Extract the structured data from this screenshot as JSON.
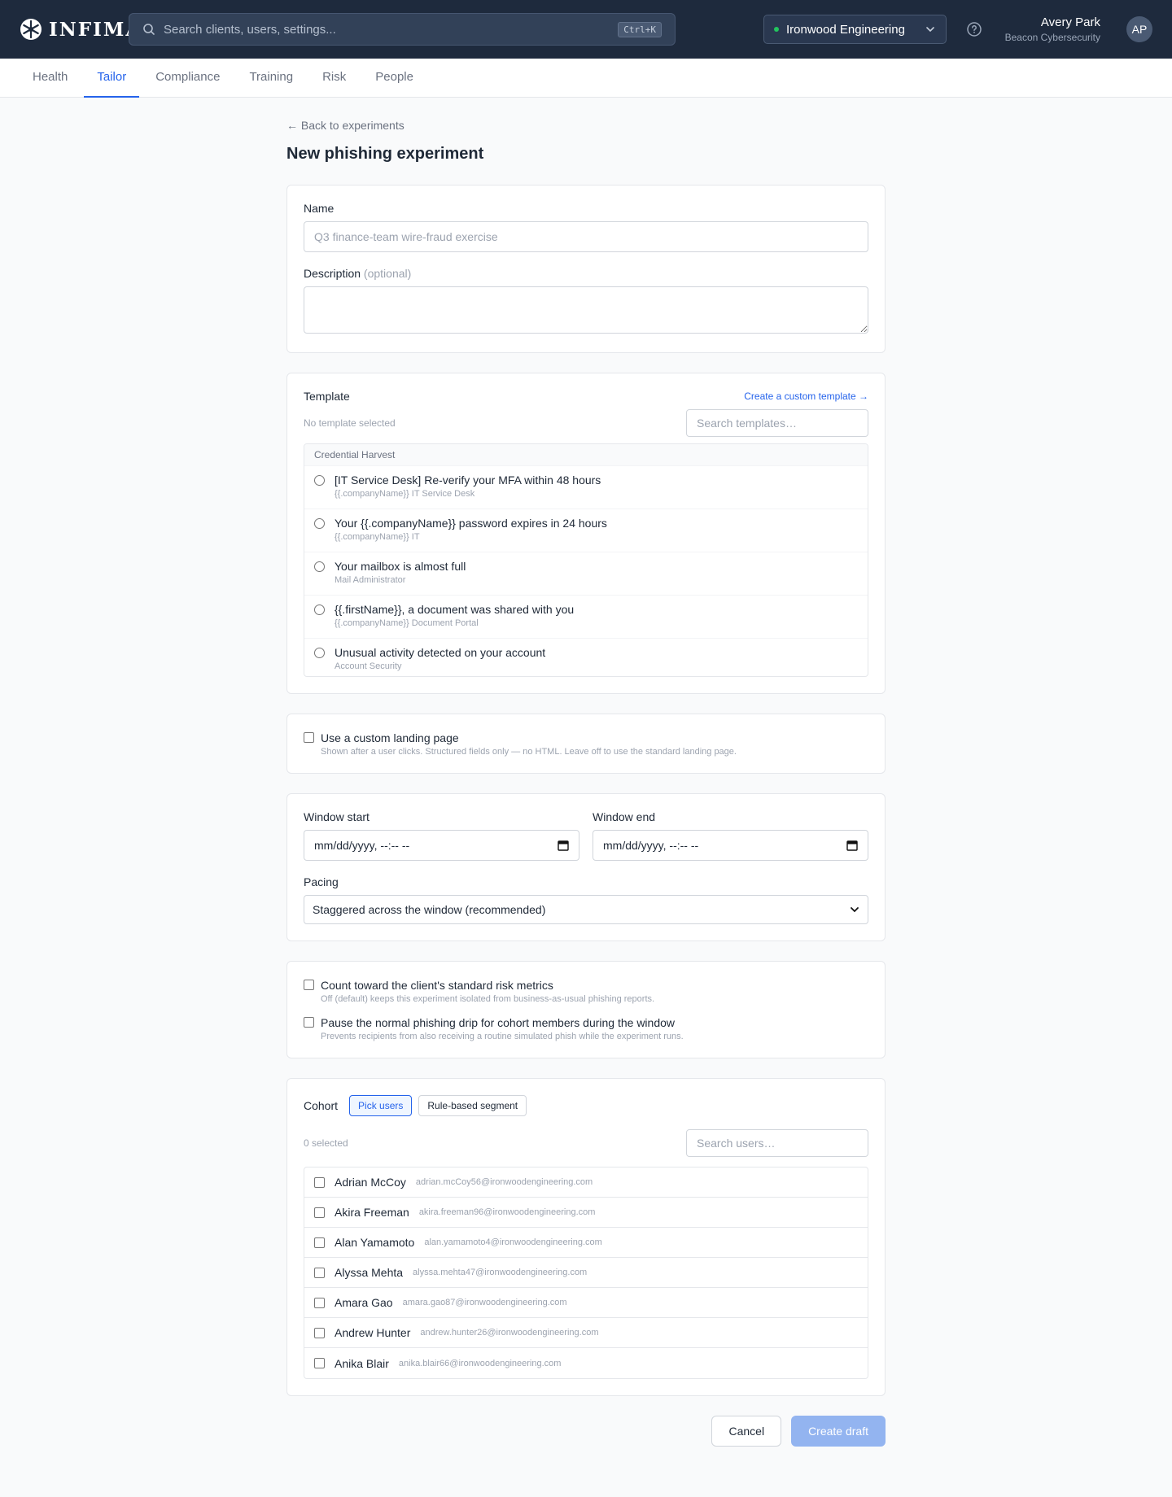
{
  "app": {
    "logo_text": "INFIMA"
  },
  "search": {
    "placeholder": "Search clients, users, settings...",
    "shortcut": "Ctrl+K"
  },
  "org_switcher": {
    "name": "Ironwood Engineering",
    "status_color": "#22c55e"
  },
  "user": {
    "name": "Avery Park",
    "org": "Beacon Cybersecurity",
    "initials": "AP"
  },
  "nav": {
    "tabs": [
      {
        "label": "Health",
        "active": false
      },
      {
        "label": "Tailor",
        "active": true
      },
      {
        "label": "Compliance",
        "active": false
      },
      {
        "label": "Training",
        "active": false
      },
      {
        "label": "Risk",
        "active": false
      },
      {
        "label": "People",
        "active": false
      }
    ]
  },
  "page": {
    "back_link": "← Back to experiments",
    "title": "New phishing experiment"
  },
  "form": {
    "name_label": "Name",
    "name_placeholder": "Q3 finance-team wire-fraud exercise",
    "description_label": "Description",
    "description_optional": "(optional)"
  },
  "template": {
    "label": "Template",
    "create_link": "Create a custom template →",
    "selected_status": "No template selected",
    "search_placeholder": "Search templates…",
    "group": "Credential Harvest",
    "items": [
      {
        "title": "[IT Service Desk] Re-verify your MFA within 48 hours",
        "sender": "{{.companyName}} IT Service Desk"
      },
      {
        "title": "Your {{.companyName}} password expires in 24 hours",
        "sender": "{{.companyName}} IT"
      },
      {
        "title": "Your mailbox is almost full",
        "sender": "Mail Administrator"
      },
      {
        "title": "{{.firstName}}, a document was shared with you",
        "sender": "{{.companyName}} Document Portal"
      },
      {
        "title": "Unusual activity detected on your account",
        "sender": "Account Security"
      }
    ]
  },
  "landing": {
    "label": "Use a custom landing page",
    "help": "Shown after a user clicks. Structured fields only — no HTML. Leave off to use the standard landing page."
  },
  "schedule": {
    "start_label": "Window start",
    "start_value": "mm/dd/yyyy, --:-- --",
    "end_label": "Window end",
    "end_value": "mm/dd/yyyy, --:-- --",
    "pacing_label": "Pacing",
    "pacing_value": "Staggered across the window (recommended)"
  },
  "options": {
    "metrics_label": "Count toward the client's standard risk metrics",
    "metrics_help": "Off (default) keeps this experiment isolated from business-as-usual phishing reports.",
    "pause_label": "Pause the normal phishing drip for cohort members during the window",
    "pause_help": "Prevents recipients from also receiving a routine simulated phish while the experiment runs."
  },
  "cohort": {
    "label": "Cohort",
    "mode_pick": "Pick users",
    "mode_rule": "Rule-based segment",
    "selected_count": "0 selected",
    "search_placeholder": "Search users…",
    "users": [
      {
        "name": "Adrian McCoy",
        "email": "adrian.mcCoy56@ironwoodengineering.com"
      },
      {
        "name": "Akira Freeman",
        "email": "akira.freeman96@ironwoodengineering.com"
      },
      {
        "name": "Alan Yamamoto",
        "email": "alan.yamamoto4@ironwoodengineering.com"
      },
      {
        "name": "Alyssa Mehta",
        "email": "alyssa.mehta47@ironwoodengineering.com"
      },
      {
        "name": "Amara Gao",
        "email": "amara.gao87@ironwoodengineering.com"
      },
      {
        "name": "Andrew Hunter",
        "email": "andrew.hunter26@ironwoodengineering.com"
      },
      {
        "name": "Anika Blair",
        "email": "anika.blair66@ironwoodengineering.com"
      }
    ]
  },
  "actions": {
    "cancel": "Cancel",
    "create": "Create draft"
  }
}
